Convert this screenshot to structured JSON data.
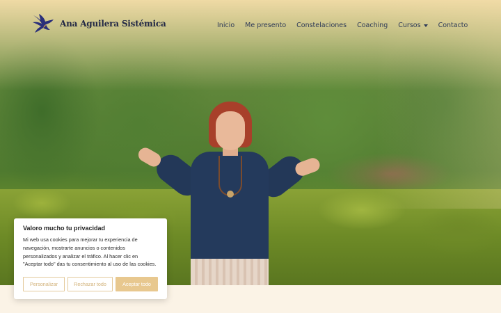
{
  "site": {
    "brand": "Ana Aguilera Sistémica",
    "logo_icon": "dove-icon",
    "colors": {
      "brand_navy": "#222845",
      "accent_gold": "#e8c88f",
      "header_fade": "#f6deaa",
      "footer_band": "#fbf3e6"
    }
  },
  "nav": {
    "items": [
      {
        "label": "Inicio"
      },
      {
        "label": "Me presento"
      },
      {
        "label": "Constelaciones"
      },
      {
        "label": "Coaching"
      },
      {
        "label": "Cursos",
        "has_dropdown": true
      },
      {
        "label": "Contacto"
      }
    ]
  },
  "cookie_banner": {
    "title": "Valoro mucho tu privacidad",
    "body": "Mi web usa cookies para mejorar tu experiencia de navegación, mostrarte anuncios o contenidos personalizados y analizar el tráfico. Al hacer clic en \"Aceptar todo\" das tu consentimiento al uso de las cookies.",
    "buttons": {
      "customize": "Personalizar",
      "reject": "Rechazar todo",
      "accept": "Aceptar todo"
    }
  }
}
